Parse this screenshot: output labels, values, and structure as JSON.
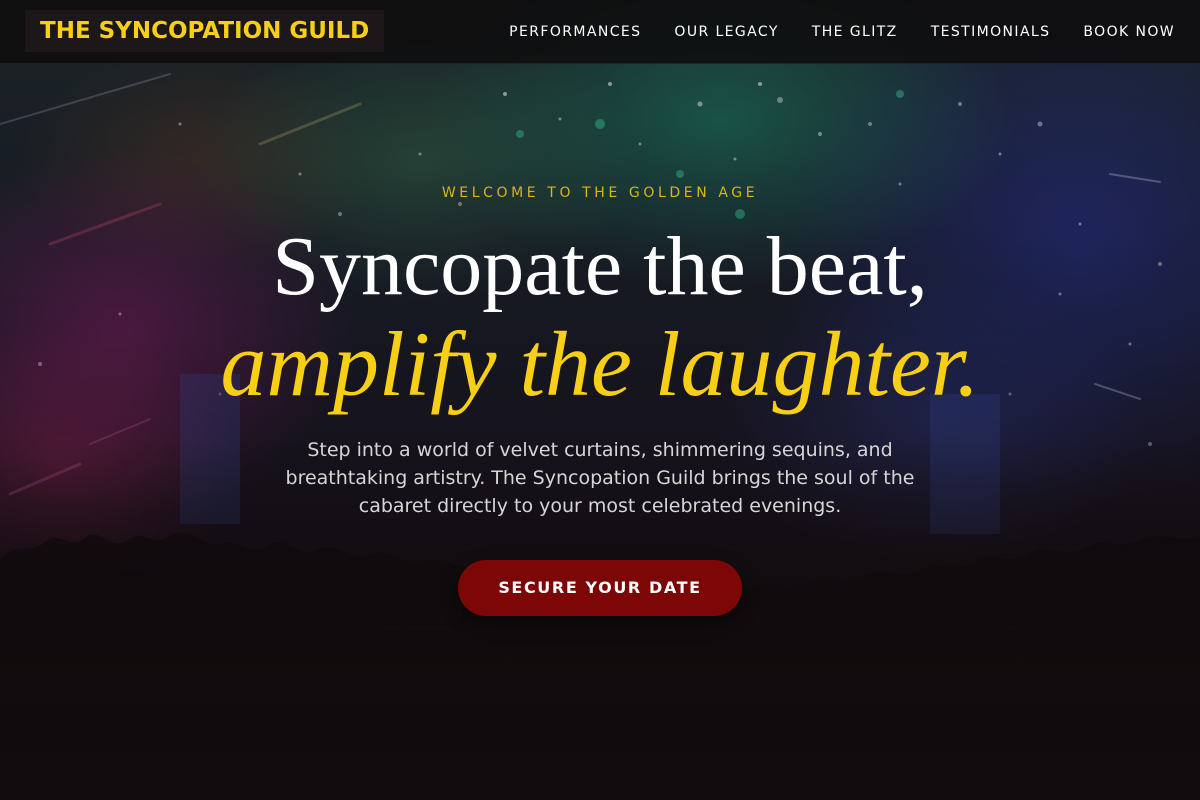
{
  "header": {
    "brand": "THE SYNCOPATION GUILD",
    "nav": [
      {
        "label": "PERFORMANCES"
      },
      {
        "label": "OUR LEGACY"
      },
      {
        "label": "THE GLITZ"
      },
      {
        "label": "TESTIMONIALS"
      },
      {
        "label": "BOOK NOW"
      }
    ]
  },
  "hero": {
    "eyebrow": "WELCOME TO THE GOLDEN AGE",
    "headline_line1": "Syncopate the beat,",
    "headline_line2": "amplify the laughter.",
    "description": "Step into a world of velvet curtains, shimmering sequins, and breathtaking artistry. The Syncopation Guild brings the soul of the cabaret directly to your most celebrated evenings.",
    "cta_label": "SECURE YOUR DATE"
  },
  "colors": {
    "accent_gold": "#f6cf16",
    "cta_red": "#7d0606",
    "background": "#120c0e"
  }
}
